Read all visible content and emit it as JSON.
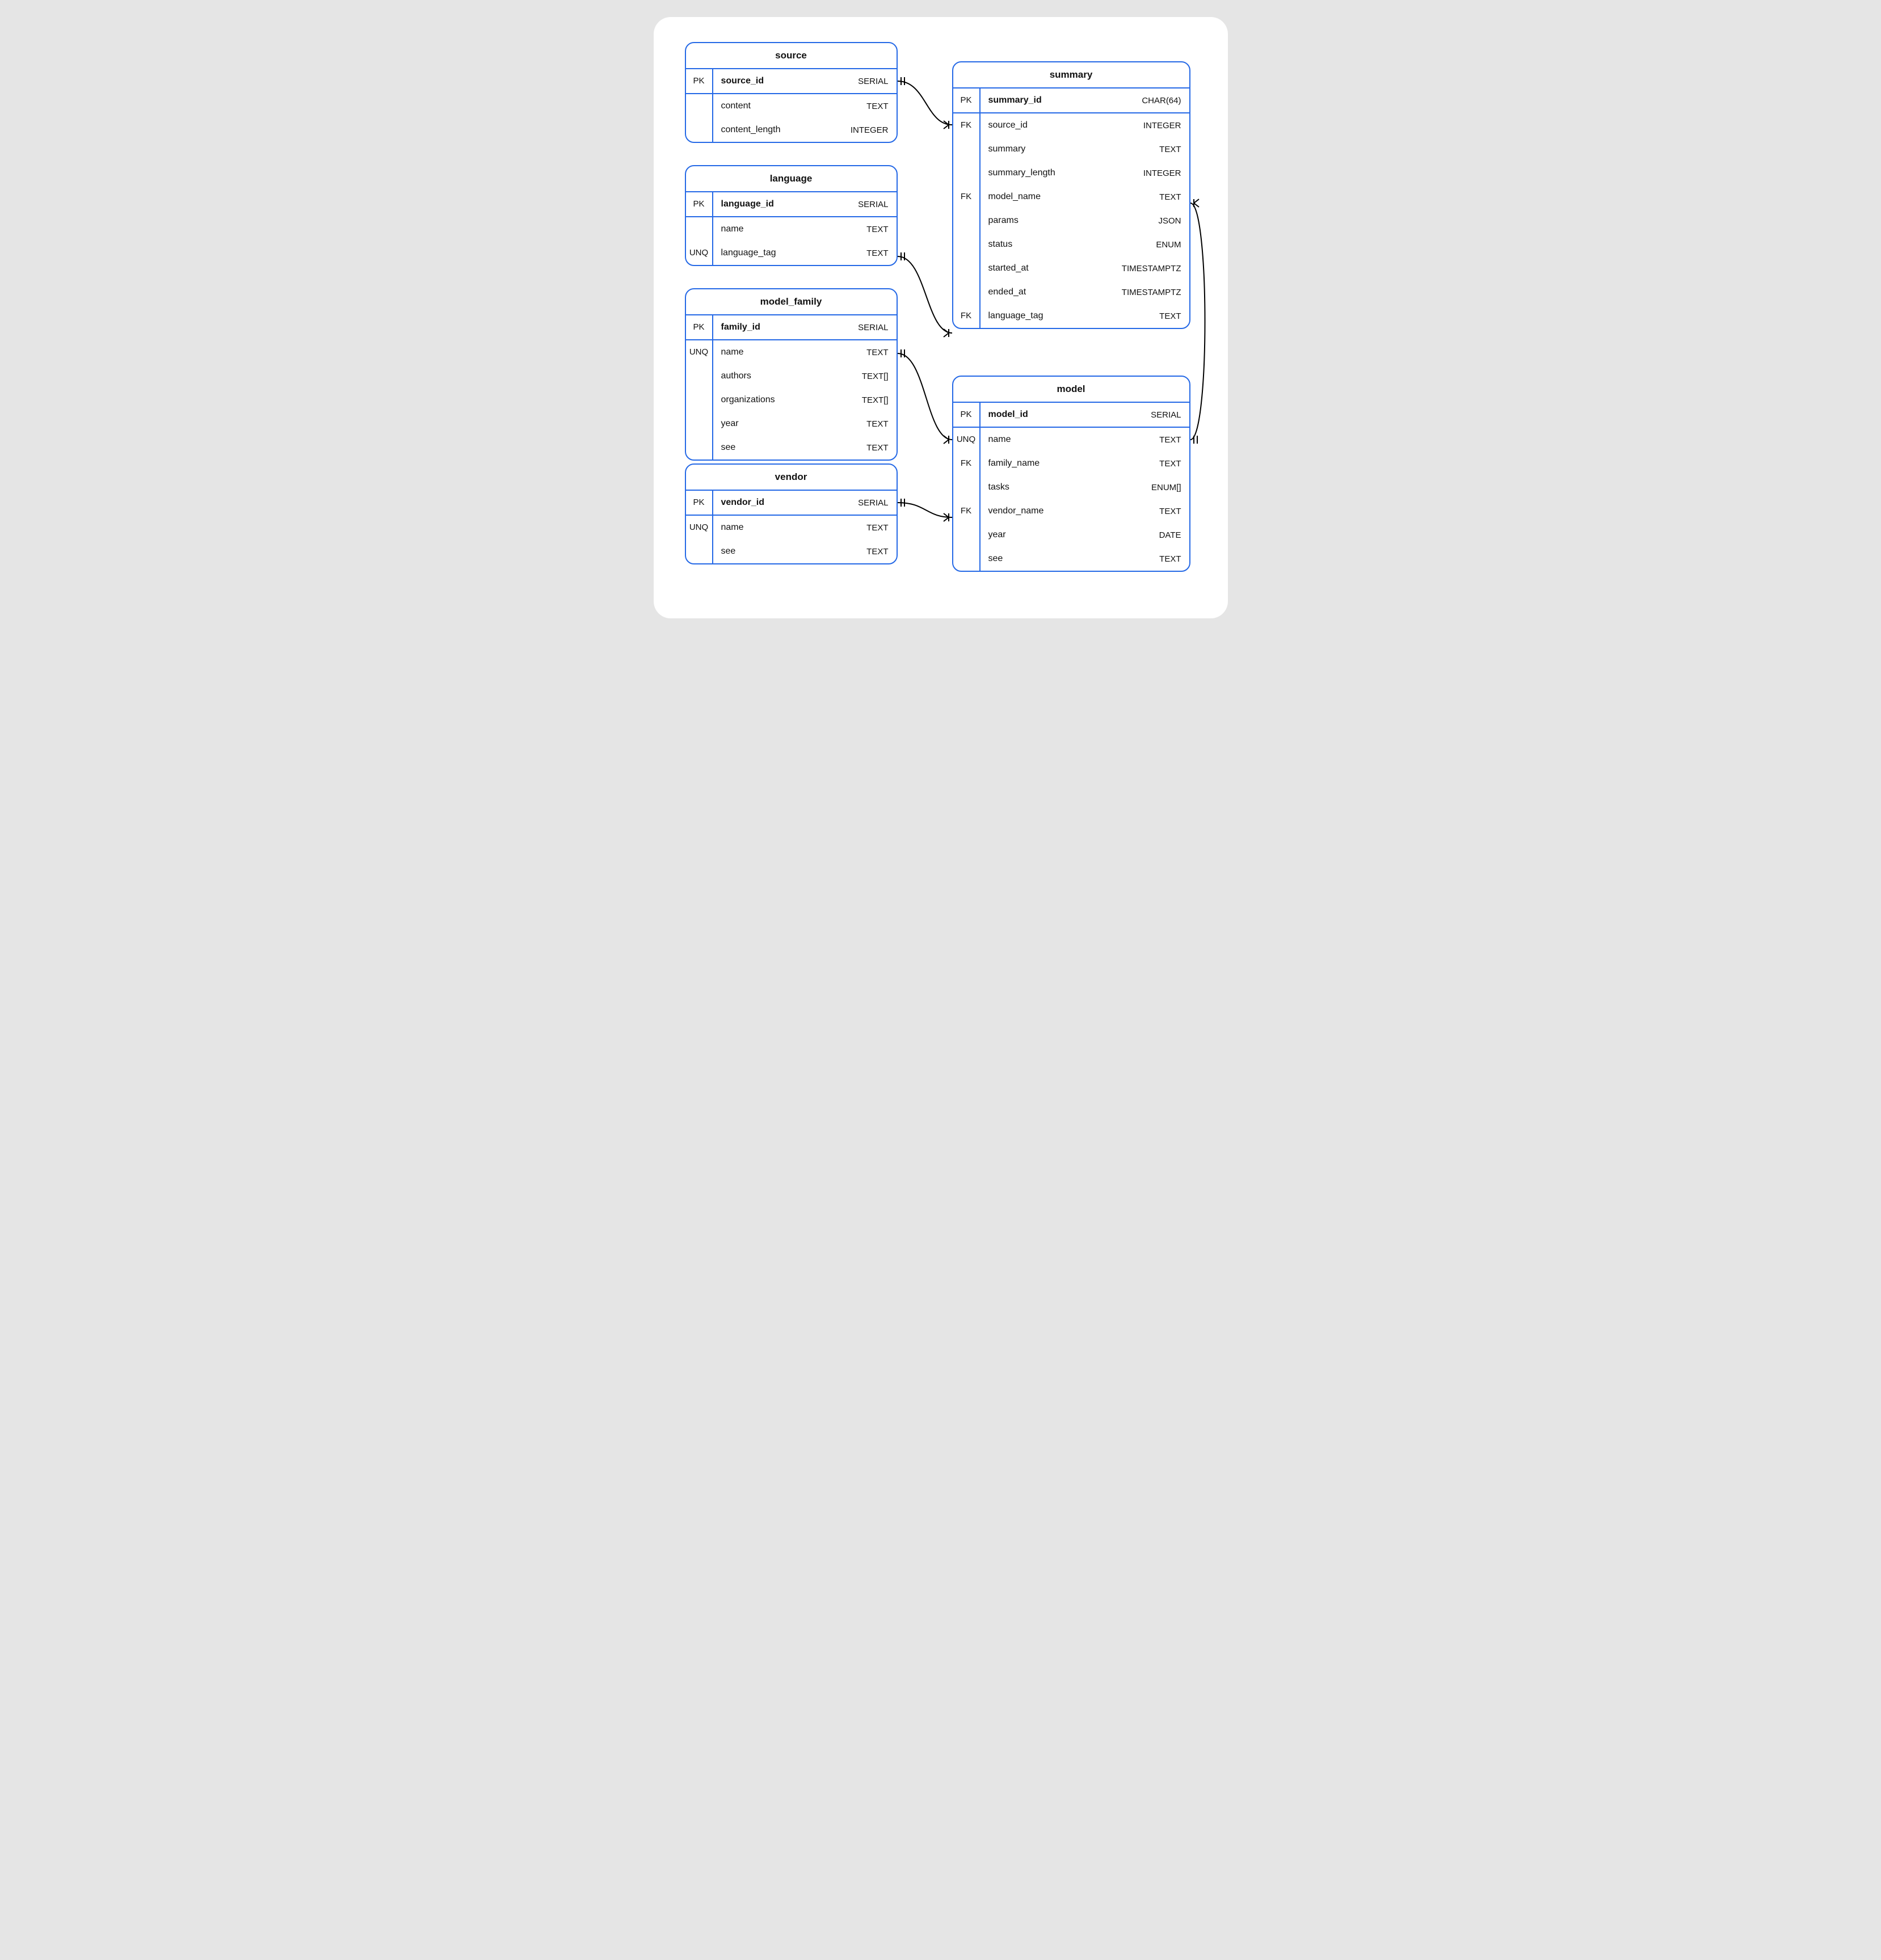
{
  "entities": {
    "source": {
      "title": "source",
      "pk": {
        "key": "PK",
        "name": "source_id",
        "type": "SERIAL"
      },
      "rows": [
        {
          "key": "",
          "name": "content",
          "type": "TEXT"
        },
        {
          "key": "",
          "name": "content_length",
          "type": "INTEGER"
        }
      ]
    },
    "language": {
      "title": "language",
      "pk": {
        "key": "PK",
        "name": "language_id",
        "type": "SERIAL"
      },
      "rows": [
        {
          "key": "",
          "name": "name",
          "type": "TEXT"
        },
        {
          "key": "UNQ",
          "name": "language_tag",
          "type": "TEXT"
        }
      ]
    },
    "model_family": {
      "title": "model_family",
      "pk": {
        "key": "PK",
        "name": "family_id",
        "type": "SERIAL"
      },
      "rows": [
        {
          "key": "UNQ",
          "name": "name",
          "type": "TEXT"
        },
        {
          "key": "",
          "name": "authors",
          "type": "TEXT[]"
        },
        {
          "key": "",
          "name": "organizations",
          "type": "TEXT[]"
        },
        {
          "key": "",
          "name": "year",
          "type": "TEXT"
        },
        {
          "key": "",
          "name": "see",
          "type": "TEXT"
        }
      ]
    },
    "vendor": {
      "title": "vendor",
      "pk": {
        "key": "PK",
        "name": "vendor_id",
        "type": "SERIAL"
      },
      "rows": [
        {
          "key": "UNQ",
          "name": "name",
          "type": "TEXT"
        },
        {
          "key": "",
          "name": "see",
          "type": "TEXT"
        }
      ]
    },
    "summary": {
      "title": "summary",
      "pk": {
        "key": "PK",
        "name": "summary_id",
        "type": "CHAR(64)"
      },
      "rows": [
        {
          "key": "FK",
          "name": "source_id",
          "type": "INTEGER"
        },
        {
          "key": "",
          "name": "summary",
          "type": "TEXT"
        },
        {
          "key": "",
          "name": "summary_length",
          "type": "INTEGER"
        },
        {
          "key": "FK",
          "name": "model_name",
          "type": "TEXT"
        },
        {
          "key": "",
          "name": "params",
          "type": "JSON"
        },
        {
          "key": "",
          "name": "status",
          "type": "ENUM"
        },
        {
          "key": "",
          "name": "started_at",
          "type": "TIMESTAMPTZ"
        },
        {
          "key": "",
          "name": "ended_at",
          "type": "TIMESTAMPTZ"
        },
        {
          "key": "FK",
          "name": "language_tag",
          "type": "TEXT"
        }
      ]
    },
    "model": {
      "title": "model",
      "pk": {
        "key": "PK",
        "name": "model_id",
        "type": "SERIAL"
      },
      "rows": [
        {
          "key": "UNQ",
          "name": "name",
          "type": "TEXT"
        },
        {
          "key": "FK",
          "name": "family_name",
          "type": "TEXT"
        },
        {
          "key": "",
          "name": "tasks",
          "type": "ENUM[]"
        },
        {
          "key": "FK",
          "name": "vendor_name",
          "type": "TEXT"
        },
        {
          "key": "",
          "name": "year",
          "type": "DATE"
        },
        {
          "key": "",
          "name": "see",
          "type": "TEXT"
        }
      ]
    }
  },
  "relationships": [
    {
      "from": "source.source_id",
      "to": "summary.source_id",
      "type": "one-to-many"
    },
    {
      "from": "language.language_tag",
      "to": "summary.language_tag",
      "type": "one-to-many"
    },
    {
      "from": "model_family.name",
      "to": "model.name",
      "type": "one-to-many"
    },
    {
      "from": "vendor.vendor_id",
      "to": "model.vendor_name",
      "type": "one-to-many"
    },
    {
      "from": "model.name",
      "to": "summary.model_name",
      "type": "one-to-many"
    }
  ]
}
